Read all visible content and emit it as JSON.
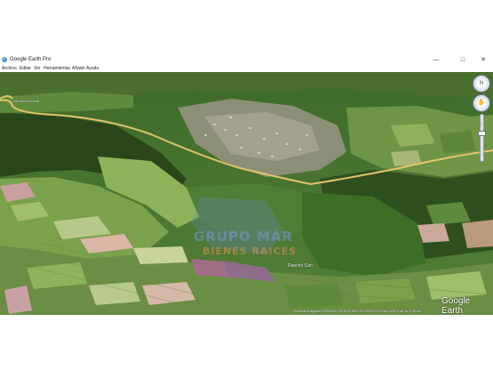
{
  "window": {
    "title": "Google Earth Pro",
    "controls": {
      "minimize": "—",
      "maximize": "□",
      "close": "✕"
    }
  },
  "menu": {
    "items": [
      "Archivo",
      "Editar",
      "Ver",
      "Herramientas",
      "Añadir",
      "Ayuda"
    ]
  },
  "map": {
    "watermark_line1": "GRUPO MAR",
    "watermark_line2": "BIENES RAICES",
    "place_label": "Rancho Can",
    "top_label": "Carretera federal",
    "logo": "Google Earth",
    "status": "Fecha de imágenes: 12/31/2021    19°39'51.88\"N 101°03'02.22\"O  elev 1123 m   alt. ojo 2.46 km"
  },
  "colors": {
    "road": "#e3c46a",
    "forest": "#2f5a1d",
    "field_green": "#6f9a47",
    "field_pink": "#c9a3a3",
    "town": "#b9b5a4"
  },
  "icons": {
    "app": "google-earth-icon",
    "navigation": "compass-ring-icon",
    "look": "look-joystick-icon",
    "zoom": "zoom-slider-icon"
  }
}
